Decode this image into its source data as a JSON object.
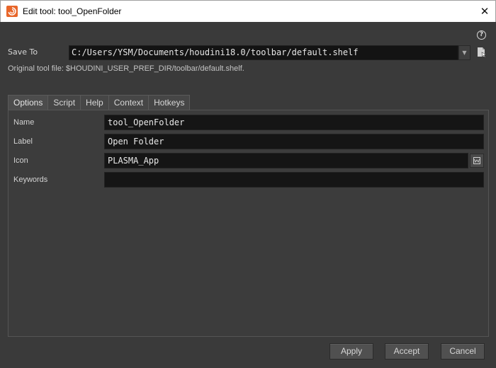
{
  "window": {
    "title": "Edit tool: tool_OpenFolder",
    "close_glyph": "✕"
  },
  "help": {
    "glyph": "?"
  },
  "save_to": {
    "label": "Save To",
    "value": "C:/Users/YSM/Documents/houdini18.0/toolbar/default.shelf"
  },
  "original_tool_file": "Original tool file: $HOUDINI_USER_PREF_DIR/toolbar/default.shelf.",
  "tabs": [
    {
      "label": "Options",
      "active": true
    },
    {
      "label": "Script"
    },
    {
      "label": "Help"
    },
    {
      "label": "Context"
    },
    {
      "label": "Hotkeys"
    }
  ],
  "fields": {
    "name": {
      "label": "Name",
      "value": "tool_OpenFolder"
    },
    "label": {
      "label": "Label",
      "value": "Open Folder"
    },
    "icon": {
      "label": "Icon",
      "value": "PLASMA_App"
    },
    "keywords": {
      "label": "Keywords",
      "value": ""
    }
  },
  "buttons": {
    "apply": "Apply",
    "accept": "Accept",
    "cancel": "Cancel"
  },
  "colors": {
    "app_icon": "#e8662a",
    "background": "#3a3a3a",
    "field_bg": "#151515"
  }
}
